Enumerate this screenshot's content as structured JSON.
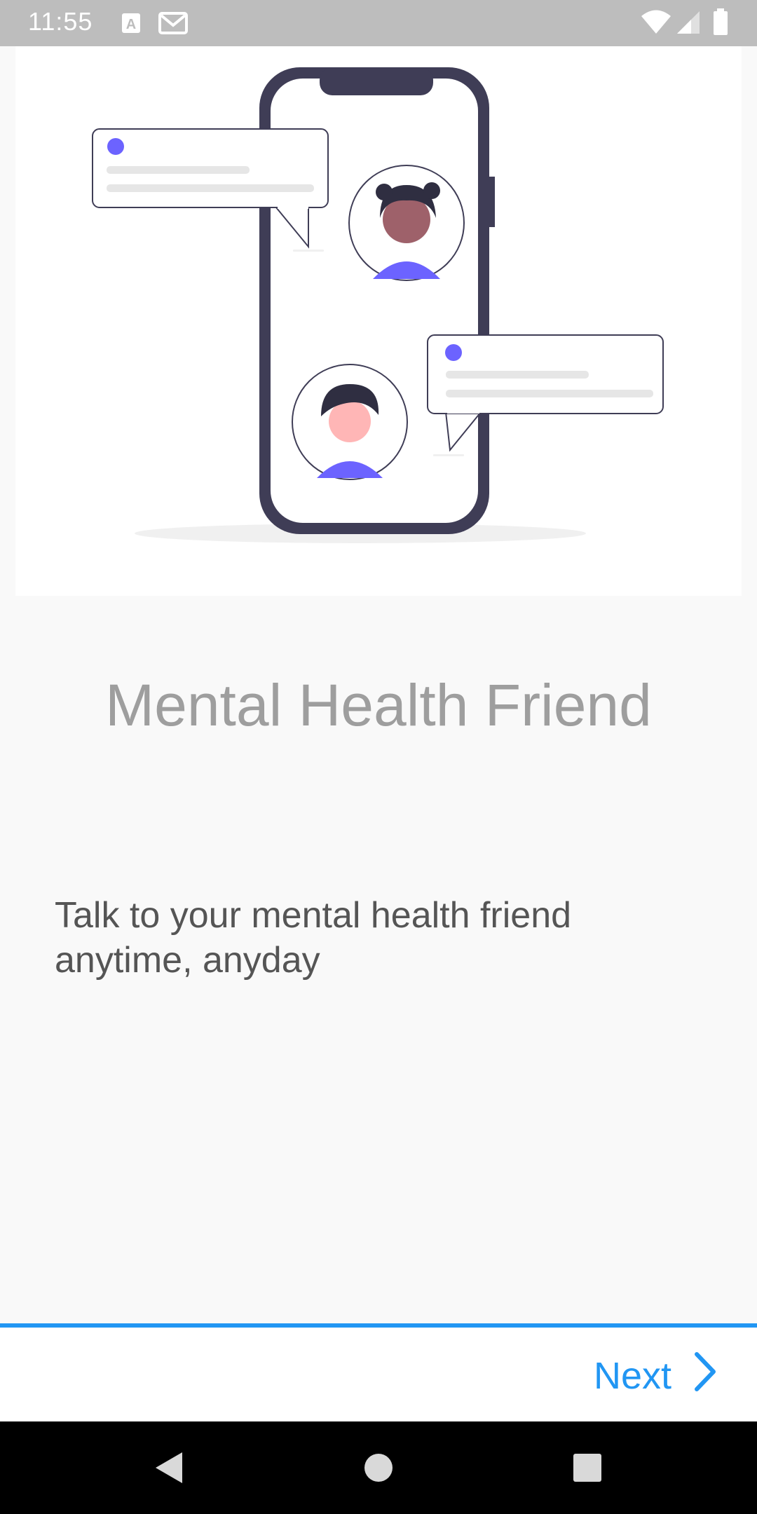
{
  "status_bar": {
    "time": "11:55",
    "left_icons": [
      "keyboard-a-icon",
      "gmail-icon"
    ],
    "right_icons": [
      "wifi-icon",
      "signal-icon",
      "battery-icon"
    ]
  },
  "onboarding": {
    "illustration": "chat-phone-illustration",
    "title": "Mental Health Friend",
    "description": "Talk to your mental health friend anytime, anyday"
  },
  "footer": {
    "next_label": "Next",
    "next_icon": "chevron-right-icon"
  },
  "nav_bar": {
    "buttons": [
      "back-icon",
      "home-icon",
      "recents-icon"
    ]
  },
  "colors": {
    "accent": "#2196f3",
    "illustration_purple": "#6c63ff",
    "illustration_dark": "#3f3d56",
    "title_gray": "#9e9e9e",
    "text_gray": "#555555"
  }
}
